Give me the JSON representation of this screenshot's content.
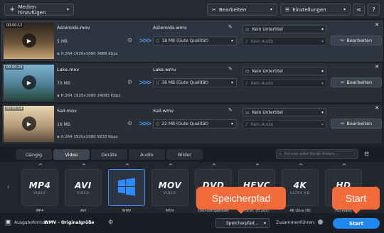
{
  "toolbar": {
    "add_media_label": "Medien hinzufügen",
    "edit_label": "Bearbeiten",
    "settings_label": "Einstellungen"
  },
  "files": [
    {
      "duration": "00:00:12",
      "name": "Asteroids.mov",
      "size": "5 MB",
      "info": "H.264 1920x1080 3688 Kbps",
      "output_name": "Asteroids.wmv",
      "output_size": "18 MB (Gute Qualität)",
      "subtitle": "Kein Untertitel",
      "audio": "Kein Audio",
      "edit_label": "Bearbeiten",
      "thumb_colors": [
        "#2b241e",
        "#6b5437",
        "#c8a676"
      ]
    },
    {
      "duration": "00:00:24",
      "name": "Lake.mov",
      "size": "70 MB",
      "info": "H.264 1920x1080 24093 Kbps",
      "output_name": "Lake.wmv",
      "output_size": "36 MB (Gute Qualität)",
      "subtitle": "Kein Untertitel",
      "audio": "Kein Audio",
      "edit_label": "Bearbeiten",
      "thumb_colors": [
        "#7fb2d0",
        "#4d7f94",
        "#274538"
      ]
    },
    {
      "duration": "00:00:14",
      "name": "Sail.mov",
      "size": "16 MB",
      "info": "H.264 1920x1080 9233 Kbps",
      "output_name": "Sail.wmv",
      "output_size": "22 MB (Gute Qualität)",
      "subtitle": "Kein Untertitel",
      "audio": "Kein Audio",
      "edit_label": "Bearbeiten",
      "thumb_colors": [
        "#e9d7b4",
        "#b49a78",
        "#5c4a3a"
      ]
    }
  ],
  "tabs": [
    "Gängig",
    "Video",
    "Geräte",
    "Audio",
    "Bilder"
  ],
  "active_tab": "Video",
  "search": {
    "placeholder": "Format oder Gerät finden..."
  },
  "formats": [
    {
      "big": "MP4",
      "small": "VIDEO",
      "label": "MP4"
    },
    {
      "big": "AVI",
      "small": "VIDEO",
      "label": "AVI"
    },
    {
      "big": "",
      "small": "",
      "label": "WMV"
    },
    {
      "big": "MOV",
      "small": "VIDEO",
      "label": "MOV"
    },
    {
      "big": "DVD",
      "small": "VIDEO",
      "label": "DVD-kompatibles Video"
    },
    {
      "big": "HEVC",
      "small": "VIDEO",
      "label": "HEVC (H.265)"
    },
    {
      "big": "4K",
      "small": "ULTRA HD",
      "label": "4K Ultra HD"
    },
    {
      "big": "HD",
      "small": "VIDEO",
      "label": "HD-Video"
    }
  ],
  "selected_format": "WMV",
  "status": {
    "output_format_label": "Ausgabeformat:",
    "output_format_value": "WMV - Originalgröße",
    "save_path_label": "Speicherpfad...",
    "merge_label": "Zusammenführen:",
    "start_label": "Start"
  },
  "callouts": {
    "save_path": "Speicherpfad",
    "start": "Start"
  },
  "colors": {
    "accent": "#1e88f0",
    "callout": "#f46b3b"
  }
}
